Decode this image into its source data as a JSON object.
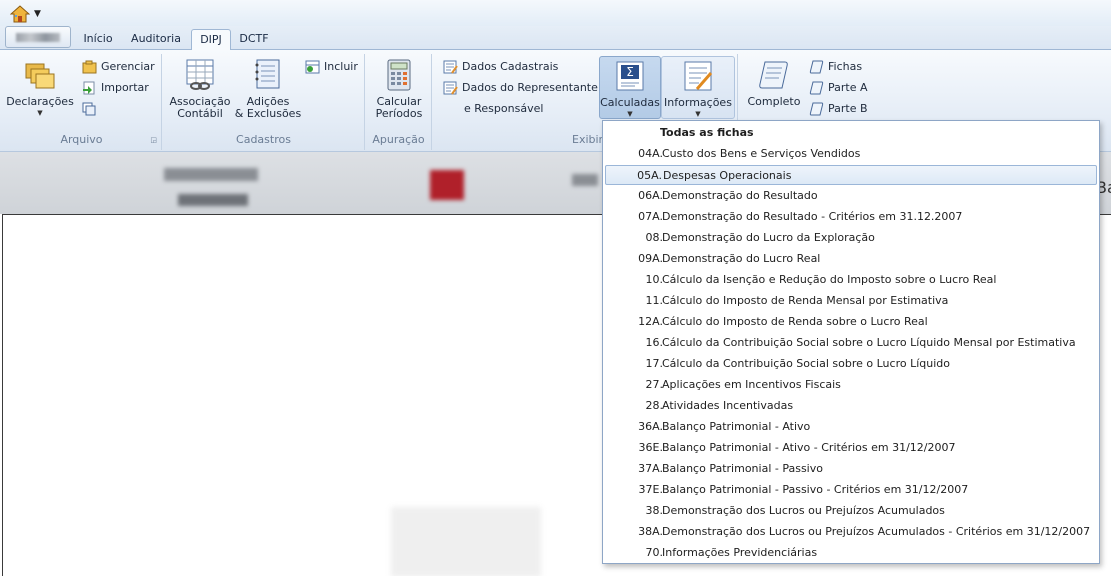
{
  "qat": {
    "home_icon": "home-icon",
    "customize_icon": "dropdown-arrow-icon"
  },
  "tabs": [
    {
      "label": "Início"
    },
    {
      "label": "Auditoria"
    },
    {
      "label": "DIPJ",
      "active": true
    },
    {
      "label": "DCTF"
    }
  ],
  "ribbon": {
    "arquivo": {
      "label": "Arquivo",
      "declaracoes": "Declarações",
      "gerenciar": "Gerenciar",
      "importar": "Importar"
    },
    "cadastros": {
      "label": "Cadastros",
      "associacao_l1": "Associação",
      "associacao_l2": "Contábil",
      "adicoes_l1": "Adições",
      "adicoes_l2": "& Exclusões",
      "incluir": "Incluir"
    },
    "apuracao": {
      "label": "Apuração",
      "calcular_l1": "Calcular",
      "calcular_l2": "Períodos"
    },
    "exibir": {
      "label": "Exibir",
      "dados_cadastrais": "Dados Cadastrais",
      "dados_representante": "Dados do Representante",
      "responsavel": "e Responsável",
      "calculadas": "Calculadas",
      "informacoes": "Informações"
    },
    "fichas": {
      "completo": "Completo",
      "fichas": "Fichas",
      "parte_a": "Parte A",
      "parte_b": "Parte B"
    }
  },
  "lower_bar": {
    "right_text": "Ba"
  },
  "dropdown": {
    "header": "Todas as fichas",
    "items": [
      {
        "code": "04A.",
        "name": "Custo dos Bens e Serviços Vendidos"
      },
      {
        "code": "05A.",
        "name": "Despesas Operacionais",
        "hover": true
      },
      {
        "code": "06A.",
        "name": "Demonstração do Resultado"
      },
      {
        "code": "07A.",
        "name": "Demonstração do Resultado - Critérios em 31.12.2007"
      },
      {
        "code": "08.",
        "name": "Demonstração do Lucro da Exploração"
      },
      {
        "code": "09A.",
        "name": "Demonstração do Lucro Real"
      },
      {
        "code": "10.",
        "name": "Cálculo da Isenção e Redução do Imposto sobre o Lucro Real"
      },
      {
        "code": "11.",
        "name": "Cálculo do Imposto de Renda Mensal por Estimativa"
      },
      {
        "code": "12A.",
        "name": "Cálculo do Imposto de Renda sobre o Lucro Real"
      },
      {
        "code": "16.",
        "name": "Cálculo da Contribuição Social sobre o Lucro Líquido Mensal por Estimativa"
      },
      {
        "code": "17.",
        "name": "Cálculo da Contribuição Social sobre o Lucro Líquido"
      },
      {
        "code": "27.",
        "name": "Aplicações em Incentivos Fiscais"
      },
      {
        "code": "28.",
        "name": "Atividades Incentivadas"
      },
      {
        "code": "36A.",
        "name": "Balanço Patrimonial - Ativo"
      },
      {
        "code": "36E.",
        "name": "Balanço Patrimonial - Ativo - Critérios em 31/12/2007"
      },
      {
        "code": "37A.",
        "name": "Balanço Patrimonial - Passivo"
      },
      {
        "code": "37E.",
        "name": "Balanço Patrimonial - Passivo - Critérios em 31/12/2007"
      },
      {
        "code": "38.",
        "name": "Demonstração dos Lucros ou Prejuízos Acumulados"
      },
      {
        "code": "38A.",
        "name": "Demonstração dos Lucros ou Prejuízos Acumulados - Critérios em 31/12/2007"
      },
      {
        "code": "70.",
        "name": "Informações Previdenciárias"
      }
    ]
  },
  "colors": {
    "ribbon_bg": "#e4ecf6",
    "hover": "#dde9f6",
    "border": "#8ea6c6"
  }
}
